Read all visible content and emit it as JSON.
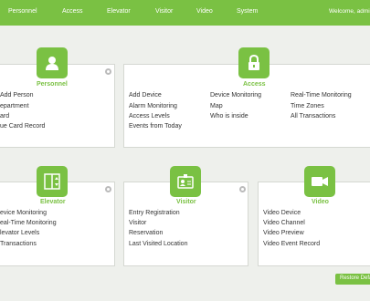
{
  "nav": {
    "items": [
      "Personnel",
      "Access",
      "Elevator",
      "Visitor",
      "Video",
      "System"
    ],
    "welcome": "Welcome, admi"
  },
  "panels": {
    "personnel": {
      "title": "Personnel",
      "icon": "person-icon",
      "links": [
        "Add Person",
        "epartment",
        "ard",
        "ue Card Record"
      ]
    },
    "access": {
      "title": "Access",
      "icon": "lock-icon",
      "columns": [
        [
          "Add Device",
          "Alarm Monitoring",
          "Access Levels",
          "Events from Today"
        ],
        [
          "Device Monitoring",
          "Map",
          "Who is inside"
        ],
        [
          "Real-Time Monitoring",
          "Time Zones",
          "All Transactions"
        ]
      ]
    },
    "elevator": {
      "title": "Elevator",
      "icon": "elevator-icon",
      "links": [
        "evice Monitoring",
        "eal-Time Monitoring",
        "levator Levels",
        "Transactions"
      ]
    },
    "visitor": {
      "title": "Visitor",
      "icon": "visitor-card-icon",
      "links": [
        "Entry Registration",
        "Visitor",
        "Reservation",
        "Last Visited Location"
      ]
    },
    "video": {
      "title": "Video",
      "icon": "camera-icon",
      "links": [
        "Video Device",
        "Video Channel",
        "Video Preview",
        "Video Event Record"
      ]
    }
  },
  "restore_button": "Restore Defa",
  "colors": {
    "accent": "#7ac143",
    "background": "#eef0ec"
  }
}
